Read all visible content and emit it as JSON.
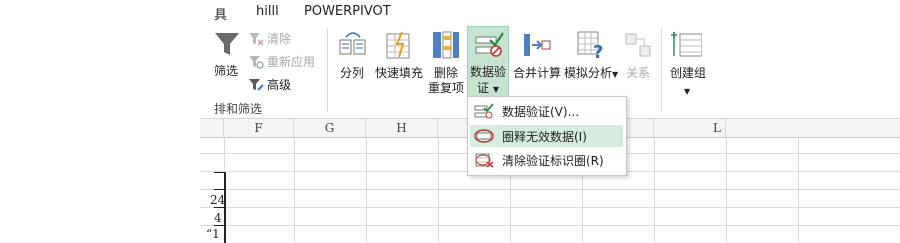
{
  "tabs": [
    "具",
    "hilll",
    "POWERPIVOT"
  ],
  "ribbon": {
    "filter_label": "筛选",
    "clear_label": "清除",
    "reapply_label": "重新应用",
    "advanced_label": "高级",
    "group_sort_filter": "排和筛选",
    "split_label": "分列",
    "flash_fill_label": "快速填充",
    "remove_dup_line1": "删除",
    "remove_dup_line2": "重复项",
    "data_validation_line1": "数据验",
    "data_validation_line2": "证",
    "consolidate_label": "合并计算",
    "whatif_label": "模拟分析",
    "relationships_label": "关系",
    "create_label": "创建组"
  },
  "grid": {
    "columns": [
      "F",
      "G",
      "H",
      "",
      "",
      "",
      "L"
    ],
    "cells": [
      "24",
      "4",
      "“1"
    ]
  },
  "menu": {
    "items": [
      {
        "label": "数据验证(V)...",
        "hover": false
      },
      {
        "label": "圈释无效数据(I)",
        "hover": true
      },
      {
        "label": "清除验证标识圈(R)",
        "hover": false
      }
    ]
  },
  "colors": {
    "accent_green": "#217346",
    "hover_bg": "#d5ecdf",
    "button_active": "#c6e4d2"
  }
}
